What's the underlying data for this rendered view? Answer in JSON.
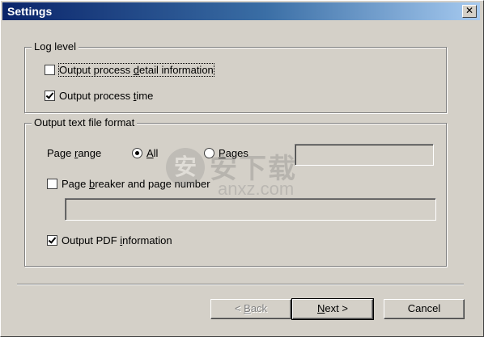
{
  "window": {
    "title": "Settings",
    "close_glyph": "✕"
  },
  "log_level": {
    "legend": "Log level",
    "detail": {
      "pre": "Output process ",
      "u": "d",
      "post": "etail information",
      "checked": false
    },
    "time": {
      "pre": "Output process ",
      "u": "t",
      "post": "ime",
      "checked": true
    }
  },
  "output_format": {
    "legend": "Output text file format",
    "page_range": {
      "pre": "Page ",
      "u": "r",
      "post": "ange"
    },
    "radio_all": {
      "pre": "",
      "u": "A",
      "post": "ll",
      "checked": true
    },
    "radio_pages": {
      "pre": "",
      "u": "P",
      "post": "ages",
      "checked": false
    },
    "pages_value": "",
    "page_breaker": {
      "pre": "Page ",
      "u": "b",
      "post": "reaker and page number",
      "checked": false
    },
    "breaker_value": "",
    "pdf_info": {
      "pre": "Output PDF ",
      "u": "i",
      "post": "nformation",
      "checked": true
    }
  },
  "buttons": {
    "back": {
      "pre": "< ",
      "u": "B",
      "post": "ack"
    },
    "next": {
      "pre": "",
      "u": "N",
      "post": "ext >"
    },
    "cancel": "Cancel"
  },
  "watermark": {
    "icon": "安",
    "cn": "安下载",
    "latin": "anxz.com"
  }
}
